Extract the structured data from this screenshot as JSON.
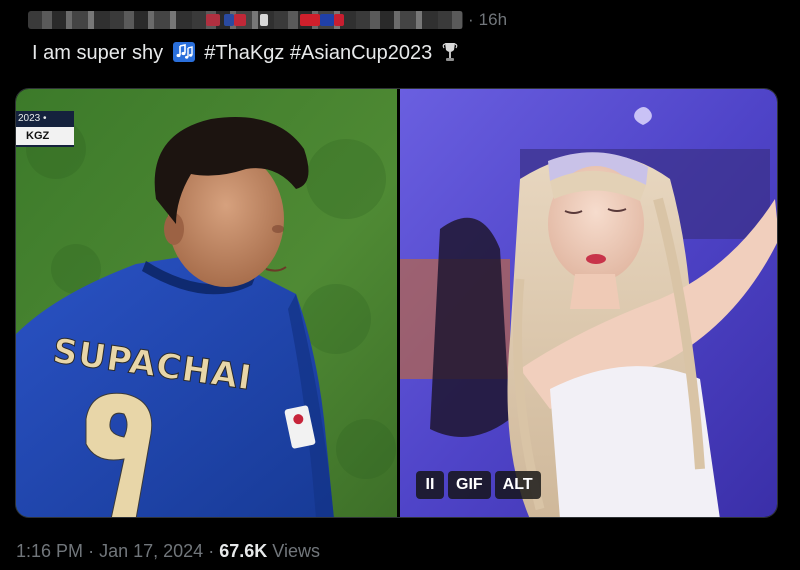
{
  "header": {
    "separator": "·",
    "relative_time": "16h"
  },
  "tweet": {
    "text_plain": "I am super shy",
    "hashtag_1": "#ThaKgz",
    "hashtag_2": "#AsianCup2023",
    "music_icon": "musical-notes-icon",
    "trophy_icon": "trophy-icon"
  },
  "media": {
    "left": {
      "scorebug_year": "2023 •",
      "scorebug_team": "KGZ",
      "jersey_name": "SUPACHAI",
      "jersey_number": "9"
    },
    "right": {
      "controls": {
        "pause_label": "II",
        "gif_label": "GIF",
        "alt_label": "ALT"
      }
    }
  },
  "footer": {
    "time": "1:16 PM",
    "sep1": "·",
    "date": "Jan 17, 2024",
    "sep2": "·",
    "views_count": "67.6K",
    "views_label": "Views"
  },
  "colors": {
    "background": "#000000",
    "text_primary": "#e7e9ea",
    "text_secondary": "#71767b",
    "jersey_blue": "#1f3f9e",
    "stage_purple": "#5a4fd6"
  }
}
